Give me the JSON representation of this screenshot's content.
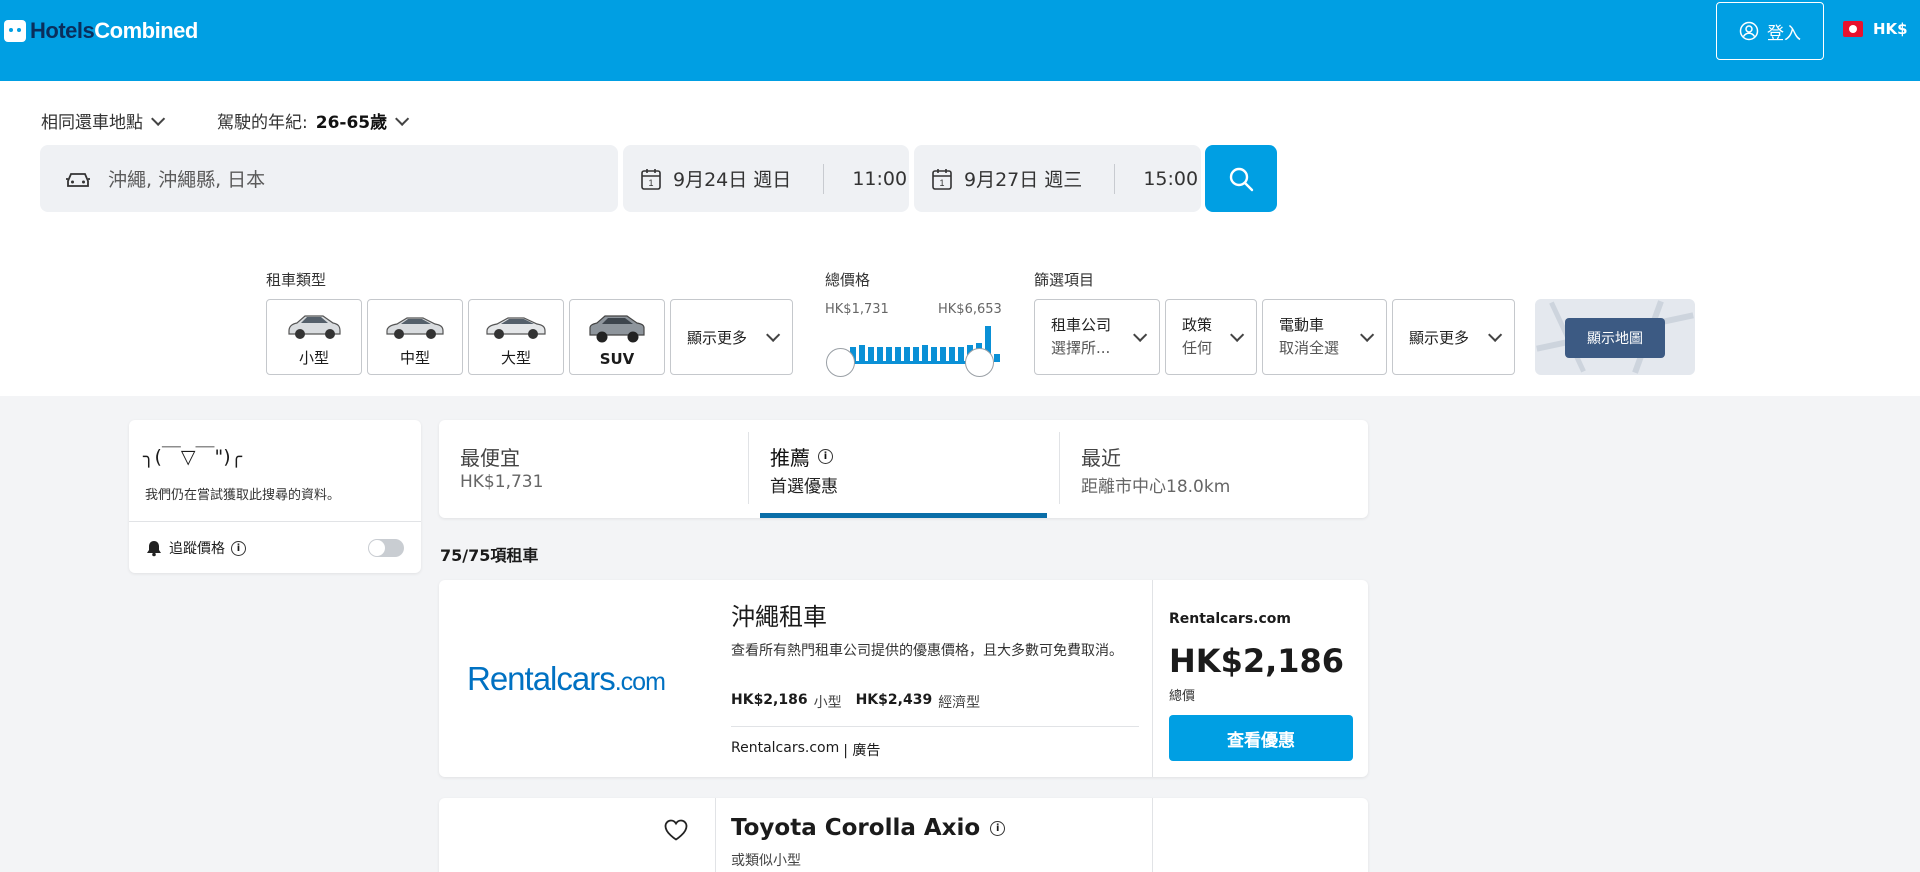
{
  "header": {
    "logo_part1": "Hotels",
    "logo_part2": "Combined",
    "login_label": "登入",
    "currency": "HK$",
    "brand_color": "#009fe3"
  },
  "search": {
    "return_option": "相同還車地點",
    "driver_age_label": "駕駛的年紀:",
    "driver_age_value": "26-65歲",
    "location": "沖繩, 沖繩縣, 日本",
    "pickup_date": "9月24日 週日",
    "pickup_time": "11:00",
    "dropoff_date": "9月27日 週三",
    "dropoff_time": "15:00"
  },
  "filters": {
    "car_type_label": "租車類型",
    "car_types": [
      "小型",
      "中型",
      "大型",
      "SUV"
    ],
    "car_more": "顯示更多",
    "price_label": "總價格",
    "price_min": "HK$1,731",
    "price_max": "HK$6,653",
    "price_histogram": [
      0.35,
      0.4,
      0.35,
      0.35,
      0.35,
      0.35,
      0.35,
      0.35,
      0.4,
      0.35,
      0.35,
      0.35,
      0.35,
      0.4,
      0.45,
      0.85,
      0.2
    ],
    "filter_label": "篩選項目",
    "company_label": "租車公司",
    "company_value": "選擇所...",
    "policy_label": "政策",
    "policy_value": "任何",
    "ev_label": "電動車",
    "ev_value": "取消全選",
    "filter_more": "顯示更多",
    "map_button": "顯示地圖"
  },
  "sidebar": {
    "face": "╮(￣▽￣\")╭",
    "message": "我們仍在嘗試獲取此搜尋的資料。",
    "track_label": "追蹤價格"
  },
  "sort_tabs": [
    {
      "title": "最便宜",
      "sub": "HK$1,731"
    },
    {
      "title": "推薦",
      "sub": "首選優惠"
    },
    {
      "title": "最近",
      "sub": "距離市中心18.0km"
    }
  ],
  "result_count": "75/75項租車",
  "ad_card": {
    "logo_text": "Rentalcars",
    "logo_suffix": ".com",
    "title": "沖繩租車",
    "description": "查看所有熱門租車公司提供的優惠價格，且大多數可免費取消。",
    "price1": "HK$2,186",
    "type1": "小型",
    "price2": "HK$2,439",
    "type2": "經濟型",
    "footer_site": "Rentalcars.com",
    "footer_ad": "| 廣告",
    "provider": "Rentalcars.com",
    "price": "HK$2,186",
    "price_note": "總價",
    "cta": "查看優惠"
  },
  "car_card": {
    "title": "Toyota Corolla Axio",
    "subtitle": "或類似小型"
  }
}
